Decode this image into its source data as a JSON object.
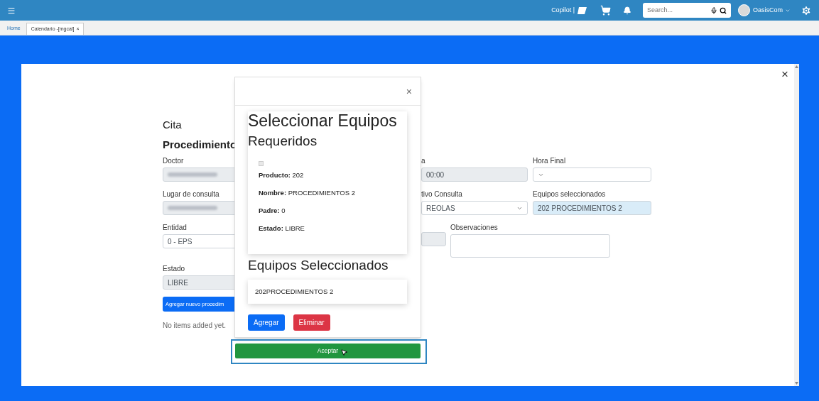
{
  "topbar": {
    "copilot_label": "Copilot |",
    "search": {
      "placeholder": "Search..."
    },
    "user": "OasisCom"
  },
  "tabs": [
    {
      "label": "Home",
      "selected": false
    },
    {
      "label": "Calendario -[mgcal]",
      "selected": true,
      "close": "×"
    }
  ],
  "panel": {
    "close": "×"
  },
  "form": {
    "title": "Cita",
    "section": "Procedimiento",
    "row_1": [
      {
        "label": "Doctor",
        "value_redacted": true
      },
      {
        "label": "a",
        "value": "00:00",
        "disabled": true
      },
      {
        "label": "Hora Final",
        "kind": "select"
      }
    ],
    "row_2": [
      {
        "label": "Lugar de consulta",
        "value_redacted": true
      },
      {
        "label": "tivo Consulta",
        "kind": "select",
        "value": "REOLAS"
      },
      {
        "label": "Equipos seleccionados",
        "value": "202 PROCEDIMIENTOS 2",
        "highlighted": true
      }
    ],
    "row_3": [
      {
        "label": "Entidad",
        "value": "0 - EPS"
      },
      {
        "label": "Observaciones",
        "kind": "textarea"
      }
    ],
    "estado": {
      "label": "Estado",
      "value": "LIBRE"
    },
    "add_button": "Agregar nuevo procedim",
    "empty_text": "No items added yet."
  },
  "modal": {
    "close": "×",
    "title": "Seleccionar Equipos",
    "required_title": "Requeridos",
    "required_items": [
      {
        "checked": false,
        "disabled": true,
        "fields": [
          {
            "label": "Producto:",
            "value": "202"
          },
          {
            "label": "Nombre:",
            "value": "PROCEDIMIENTOS 2"
          },
          {
            "label": "Padre:",
            "value": "0"
          },
          {
            "label": "Estado:",
            "value": "LIBRE"
          }
        ]
      }
    ],
    "selected_title": "Equipos Seleccionados",
    "selected_items": [
      "202PROCEDIMIENTOS 2"
    ],
    "buttons": [
      {
        "label": "Agregar",
        "kind": "primary"
      },
      {
        "label": "Eliminar",
        "kind": "danger"
      }
    ],
    "accept": {
      "label": "Aceptar",
      "highlighted": true
    }
  }
}
